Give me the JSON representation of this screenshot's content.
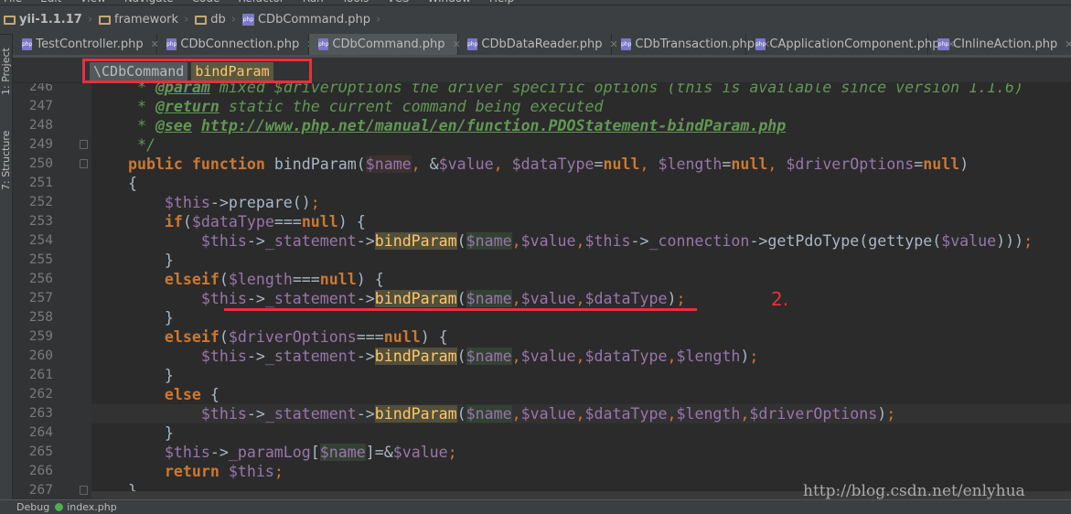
{
  "menu": [
    "File",
    "Edit",
    "View",
    "Navigate",
    "Code",
    "Refactor",
    "Run",
    "Tools",
    "VCS",
    "Window",
    "Help"
  ],
  "breadcrumbs": [
    {
      "label": "yii-1.1.17",
      "icon": "folder-icon"
    },
    {
      "label": "framework",
      "icon": "folder-icon"
    },
    {
      "label": "db",
      "icon": "folder-icon"
    },
    {
      "label": "CDbCommand.php",
      "icon": "php-file-icon"
    }
  ],
  "tool_windows": {
    "project": "1: Project",
    "structure": "7: Structure"
  },
  "tabs": [
    {
      "label": "TestController.php",
      "active": false,
      "w": 158
    },
    {
      "label": "CDbConnection.php",
      "active": false,
      "w": 166
    },
    {
      "label": "CDbCommand.php",
      "active": true,
      "w": 163
    },
    {
      "label": "CDbDataReader.php",
      "active": false,
      "w": 168
    },
    {
      "label": "CDbTransaction.php",
      "active": false,
      "w": 147
    },
    {
      "label": "CApplicationComponent.php",
      "active": false,
      "w": 199
    },
    {
      "label": "CInlineAction.php",
      "active": false,
      "w": 170
    }
  ],
  "navbar": {
    "class": "\\CDbCommand",
    "method": "bindParam"
  },
  "code": {
    "current_line": 263,
    "lines": [
      {
        "n": 246,
        "t": [
          [
            "cm",
            "     * "
          ],
          [
            "tag",
            "@param"
          ],
          [
            "cm",
            " mixed $driverOptions the driver specific options (this is available since version 1.1.6)"
          ]
        ]
      },
      {
        "n": 247,
        "t": [
          [
            "cm",
            "     * "
          ],
          [
            "tag",
            "@return"
          ],
          [
            "cm",
            " static the current command being executed"
          ]
        ]
      },
      {
        "n": 248,
        "t": [
          [
            "cm",
            "     * "
          ],
          [
            "tag",
            "@see"
          ],
          [
            "cm",
            " "
          ],
          [
            "link",
            "http://www.php.net/manual/en/function.PDOStatement-bindParam.php"
          ]
        ]
      },
      {
        "n": 249,
        "fold": true,
        "t": [
          [
            "cm",
            "     */"
          ]
        ]
      },
      {
        "n": 250,
        "fold": true,
        "t": [
          [
            "kw",
            "    public function "
          ],
          [
            "fnp",
            "bindParam("
          ],
          [
            "nmd",
            "$name"
          ],
          [
            "punc",
            ", "
          ],
          [
            "pl",
            "&"
          ],
          [
            "var",
            "$value"
          ],
          [
            "punc",
            ", "
          ],
          [
            "var",
            "$dataType"
          ],
          [
            "pl",
            "="
          ],
          [
            "kw",
            "null"
          ],
          [
            "punc",
            ", "
          ],
          [
            "var",
            "$length"
          ],
          [
            "pl",
            "="
          ],
          [
            "kw",
            "null"
          ],
          [
            "punc",
            ", "
          ],
          [
            "var",
            "$driverOptions"
          ],
          [
            "pl",
            "="
          ],
          [
            "kw",
            "null"
          ],
          [
            "pl",
            ")"
          ]
        ]
      },
      {
        "n": 251,
        "t": [
          [
            "pl",
            "    {"
          ]
        ]
      },
      {
        "n": 252,
        "t": [
          [
            "var",
            "        $this"
          ],
          [
            "pl",
            "->prepare()"
          ],
          [
            "punc",
            ";"
          ]
        ]
      },
      {
        "n": 253,
        "t": [
          [
            "kw",
            "        if"
          ],
          [
            "pl",
            "("
          ],
          [
            "var",
            "$dataType"
          ],
          [
            "pl",
            "==="
          ],
          [
            "kw",
            "null"
          ],
          [
            "pl",
            ") {"
          ]
        ]
      },
      {
        "n": 254,
        "t": [
          [
            "var",
            "            $this"
          ],
          [
            "pl",
            "->"
          ],
          [
            "fld",
            "_statement"
          ],
          [
            "pl",
            "->"
          ],
          [
            "fn",
            "bindParam"
          ],
          [
            "pl",
            "("
          ],
          [
            "nm",
            "$name"
          ],
          [
            "punc",
            ","
          ],
          [
            "var",
            "$value"
          ],
          [
            "punc",
            ","
          ],
          [
            "var",
            "$this"
          ],
          [
            "pl",
            "->"
          ],
          [
            "fld",
            "_connection"
          ],
          [
            "pl",
            "->"
          ],
          [
            "fnp",
            "getPdoType(gettype("
          ],
          [
            "var",
            "$value"
          ],
          [
            "pl",
            ")))"
          ],
          [
            "punc",
            ";"
          ]
        ]
      },
      {
        "n": 255,
        "t": [
          [
            "pl",
            "        }"
          ]
        ]
      },
      {
        "n": 256,
        "t": [
          [
            "kw",
            "        elseif"
          ],
          [
            "pl",
            "("
          ],
          [
            "var",
            "$length"
          ],
          [
            "pl",
            "==="
          ],
          [
            "kw",
            "null"
          ],
          [
            "pl",
            ") {"
          ]
        ]
      },
      {
        "n": 257,
        "t": [
          [
            "var",
            "            $this"
          ],
          [
            "pl",
            "->"
          ],
          [
            "fld",
            "_statement"
          ],
          [
            "pl",
            "->"
          ],
          [
            "fn",
            "bindParam"
          ],
          [
            "pl",
            "("
          ],
          [
            "nm",
            "$name"
          ],
          [
            "punc",
            ","
          ],
          [
            "var",
            "$value"
          ],
          [
            "punc",
            ","
          ],
          [
            "var",
            "$dataType"
          ],
          [
            "pl",
            ")"
          ],
          [
            "punc",
            ";"
          ]
        ]
      },
      {
        "n": 258,
        "t": [
          [
            "pl",
            "        }"
          ]
        ]
      },
      {
        "n": 259,
        "t": [
          [
            "kw",
            "        elseif"
          ],
          [
            "pl",
            "("
          ],
          [
            "var",
            "$driverOptions"
          ],
          [
            "pl",
            "==="
          ],
          [
            "kw",
            "null"
          ],
          [
            "pl",
            ") {"
          ]
        ]
      },
      {
        "n": 260,
        "t": [
          [
            "var",
            "            $this"
          ],
          [
            "pl",
            "->"
          ],
          [
            "fld",
            "_statement"
          ],
          [
            "pl",
            "->"
          ],
          [
            "fn",
            "bindParam"
          ],
          [
            "pl",
            "("
          ],
          [
            "nm",
            "$name"
          ],
          [
            "punc",
            ","
          ],
          [
            "var",
            "$value"
          ],
          [
            "punc",
            ","
          ],
          [
            "var",
            "$dataType"
          ],
          [
            "punc",
            ","
          ],
          [
            "var",
            "$length"
          ],
          [
            "pl",
            ")"
          ],
          [
            "punc",
            ";"
          ]
        ]
      },
      {
        "n": 261,
        "t": [
          [
            "pl",
            "        }"
          ]
        ]
      },
      {
        "n": 262,
        "t": [
          [
            "kw",
            "        else "
          ],
          [
            "pl",
            "{"
          ]
        ]
      },
      {
        "n": 263,
        "t": [
          [
            "var",
            "            $this"
          ],
          [
            "pl",
            "->"
          ],
          [
            "fld",
            "_statement"
          ],
          [
            "pl",
            "->"
          ],
          [
            "fn",
            "bindParam"
          ],
          [
            "pl",
            "("
          ],
          [
            "nm",
            "$name"
          ],
          [
            "punc",
            ","
          ],
          [
            "var",
            "$value"
          ],
          [
            "punc",
            ","
          ],
          [
            "var",
            "$dataType"
          ],
          [
            "punc",
            ","
          ],
          [
            "var",
            "$length"
          ],
          [
            "punc",
            ","
          ],
          [
            "var",
            "$driverOptions"
          ],
          [
            "pl",
            ")"
          ],
          [
            "punc",
            ";"
          ]
        ]
      },
      {
        "n": 264,
        "t": [
          [
            "pl",
            "        }"
          ]
        ]
      },
      {
        "n": 265,
        "t": [
          [
            "var",
            "        $this"
          ],
          [
            "pl",
            "->"
          ],
          [
            "fld",
            "_paramLog"
          ],
          [
            "pl",
            "["
          ],
          [
            "nm",
            "$name"
          ],
          [
            "pl",
            "]=&"
          ],
          [
            "var",
            "$value"
          ],
          [
            "punc",
            ";"
          ]
        ]
      },
      {
        "n": 266,
        "t": [
          [
            "kw",
            "        return "
          ],
          [
            "var",
            "$this"
          ],
          [
            "punc",
            ";"
          ]
        ]
      },
      {
        "n": 267,
        "fold": true,
        "t": [
          [
            "pl",
            "    }"
          ]
        ]
      }
    ]
  },
  "annotation": {
    "label": "2.",
    "color": "#e8303a"
  },
  "watermark": "http://blog.csdn.net/enlyhua",
  "status": {
    "debug": "Debug",
    "file": "index.php"
  },
  "colors": {
    "background": "#2b2b2b",
    "keyword": "#cc7832",
    "variable": "#9876aa",
    "comment": "#629755",
    "function": "#ffc66d",
    "highlight_box": "#e8303a"
  }
}
